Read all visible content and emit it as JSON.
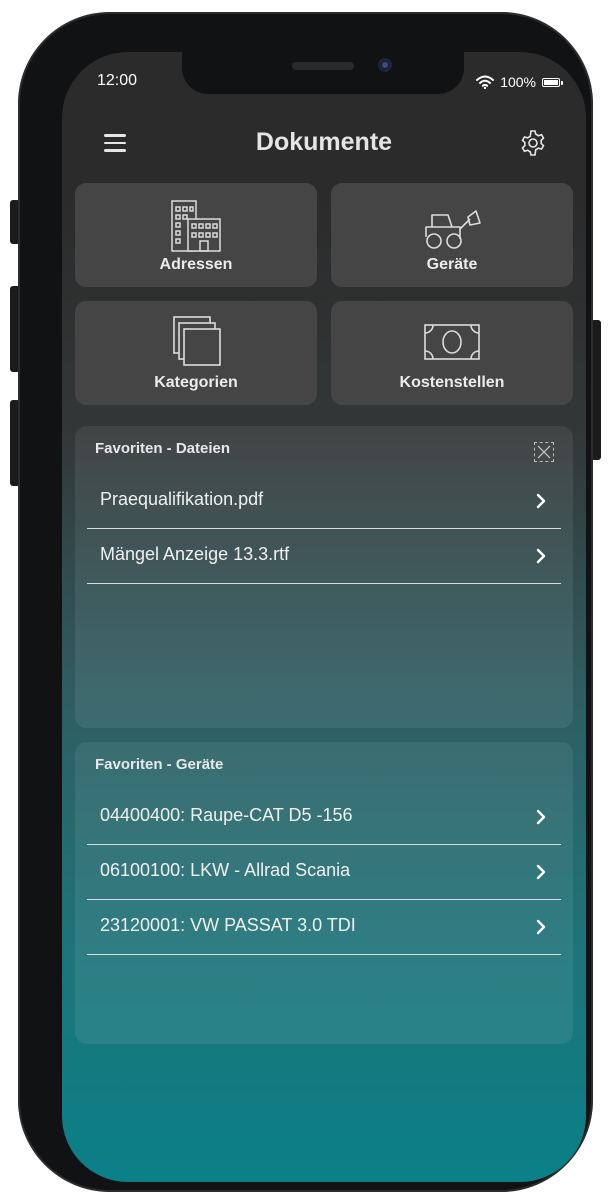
{
  "status": {
    "time": "12:00",
    "battery": "100%"
  },
  "header": {
    "title": "Dokumente"
  },
  "tiles": [
    {
      "label": "Adressen",
      "icon": "buildings-icon"
    },
    {
      "label": "Geräte",
      "icon": "loader-vehicle-icon"
    },
    {
      "label": "Kategorien",
      "icon": "stacked-squares-icon"
    },
    {
      "label": "Kostenstellen",
      "icon": "banknote-icon"
    }
  ],
  "favorites_files": {
    "title": "Favoriten - Dateien",
    "items": [
      "Praequalifikation.pdf",
      "Mängel Anzeige 13.3.rtf"
    ]
  },
  "favorites_devices": {
    "title": "Favoriten - Geräte",
    "items": [
      "04400400: Raupe-CAT D5 -156",
      "06100100: LKW - Allrad Scania",
      "23120001: VW PASSAT 3.0 TDI"
    ]
  },
  "colors": {
    "tile_bg": "#454546",
    "teal_bottom": "#0a8088",
    "header_bg": "#2b2b2c"
  }
}
